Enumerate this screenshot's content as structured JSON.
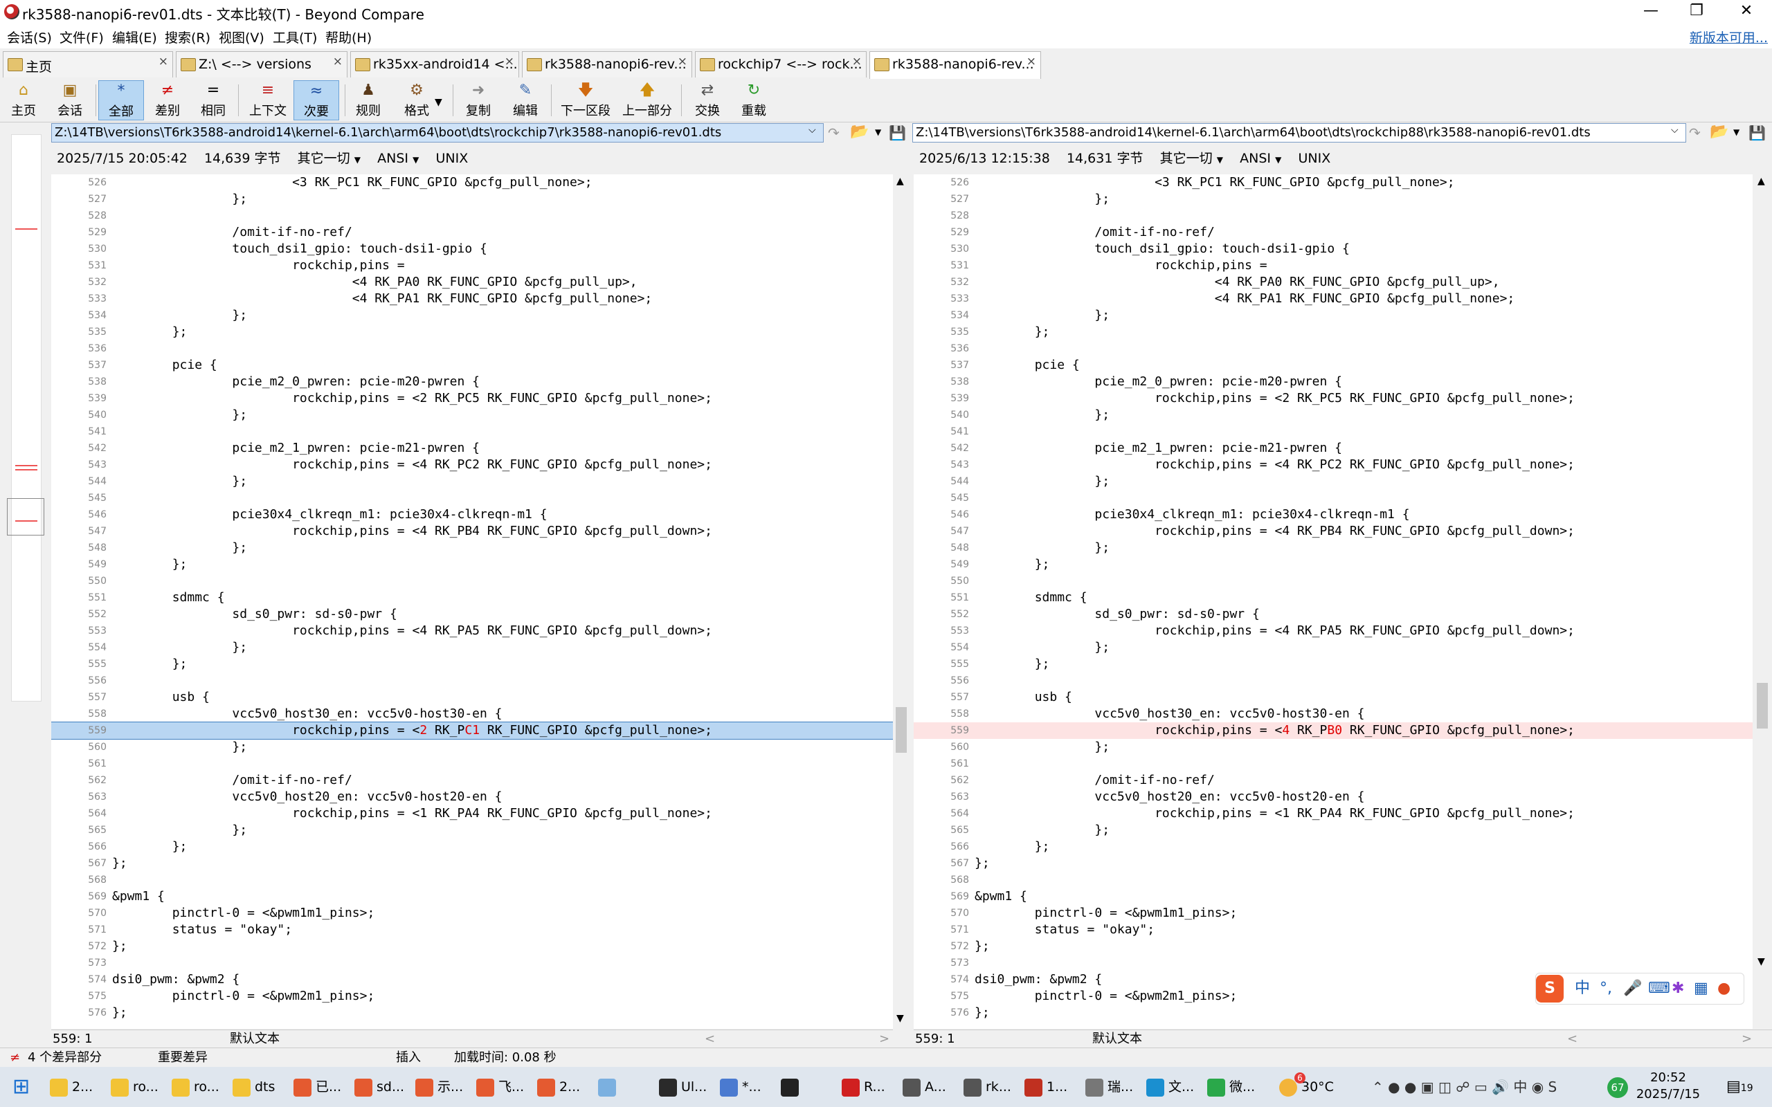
{
  "window": {
    "title": "rk3588-nanopi6-rev01.dts - 文本比较(T) - Beyond Compare"
  },
  "menu": {
    "items": [
      "会话(S)",
      "文件(F)",
      "编辑(E)",
      "搜索(R)",
      "视图(V)",
      "工具(T)",
      "帮助(H)"
    ],
    "new_version": "新版本可用..."
  },
  "tabs": [
    {
      "label": "主页"
    },
    {
      "label": "Z:\\ <--> versions"
    },
    {
      "label": "rk35xx-android14 <..."
    },
    {
      "label": "rk3588-nanopi6-rev..."
    },
    {
      "label": "rockchip7 <--> rock..."
    },
    {
      "label": "rk3588-nanopi6-rev..."
    }
  ],
  "toolbar": {
    "home": "主页",
    "session": "会话",
    "all": "全部",
    "diff": "差别",
    "same": "相同",
    "context": "上下文",
    "minor": "次要",
    "rules": "规则",
    "format": "格式",
    "copy": "复制",
    "edit": "编辑",
    "next_section": "下一区段",
    "prev_section": "上一部分",
    "swap": "交换",
    "reload": "重载"
  },
  "left": {
    "path": "Z:\\14TB\\versions\\T6rk3588-android14\\kernel-6.1\\arch\\arm64\\boot\\dts\\rockchip7\\rk3588-nanopi6-rev01.dts",
    "date": "2025/7/15 20:05:42",
    "size": "14,639 字节",
    "mode": "其它一切",
    "encoding": "ANSI",
    "eol": "UNIX",
    "pos": "559: 1",
    "syntax": "默认文本"
  },
  "right": {
    "path": "Z:\\14TB\\versions\\T6rk3588-android14\\kernel-6.1\\arch\\arm64\\boot\\dts\\rockchip88\\rk3588-nanopi6-rev01.dts",
    "date": "2025/6/13 12:15:38",
    "size": "14,631 字节",
    "mode": "其它一切",
    "encoding": "ANSI",
    "eol": "UNIX",
    "pos": "559: 1",
    "syntax": "默认文本"
  },
  "lines": [
    {
      "n": "526",
      "t": "                        <3 RK_PC1 RK_FUNC_GPIO &pcfg_pull_none>;"
    },
    {
      "n": "527",
      "t": "                };"
    },
    {
      "n": "528",
      "t": ""
    },
    {
      "n": "529",
      "t": "                /omit-if-no-ref/"
    },
    {
      "n": "530",
      "t": "                touch_dsi1_gpio: touch-dsi1-gpio {"
    },
    {
      "n": "531",
      "t": "                        rockchip,pins ="
    },
    {
      "n": "532",
      "t": "                                <4 RK_PA0 RK_FUNC_GPIO &pcfg_pull_up>,"
    },
    {
      "n": "533",
      "t": "                                <4 RK_PA1 RK_FUNC_GPIO &pcfg_pull_none>;"
    },
    {
      "n": "534",
      "t": "                };"
    },
    {
      "n": "535",
      "t": "        };"
    },
    {
      "n": "536",
      "t": ""
    },
    {
      "n": "537",
      "t": "        pcie {"
    },
    {
      "n": "538",
      "t": "                pcie_m2_0_pwren: pcie-m20-pwren {"
    },
    {
      "n": "539",
      "t": "                        rockchip,pins = <2 RK_PC5 RK_FUNC_GPIO &pcfg_pull_none>;"
    },
    {
      "n": "540",
      "t": "                };"
    },
    {
      "n": "541",
      "t": ""
    },
    {
      "n": "542",
      "t": "                pcie_m2_1_pwren: pcie-m21-pwren {"
    },
    {
      "n": "543",
      "t": "                        rockchip,pins = <4 RK_PC2 RK_FUNC_GPIO &pcfg_pull_none>;"
    },
    {
      "n": "544",
      "t": "                };"
    },
    {
      "n": "545",
      "t": ""
    },
    {
      "n": "546",
      "t": "                pcie30x4_clkreqn_m1: pcie30x4-clkreqn-m1 {"
    },
    {
      "n": "547",
      "t": "                        rockchip,pins = <4 RK_PB4 RK_FUNC_GPIO &pcfg_pull_down>;"
    },
    {
      "n": "548",
      "t": "                };"
    },
    {
      "n": "549",
      "t": "        };"
    },
    {
      "n": "550",
      "t": ""
    },
    {
      "n": "551",
      "t": "        sdmmc {"
    },
    {
      "n": "552",
      "t": "                sd_s0_pwr: sd-s0-pwr {"
    },
    {
      "n": "553",
      "t": "                        rockchip,pins = <4 RK_PA5 RK_FUNC_GPIO &pcfg_pull_down>;"
    },
    {
      "n": "554",
      "t": "                };"
    },
    {
      "n": "555",
      "t": "        };"
    },
    {
      "n": "556",
      "t": ""
    },
    {
      "n": "557",
      "t": "        usb {"
    },
    {
      "n": "558",
      "t": "                vcc5v0_host30_en: vcc5v0-host30-en {"
    },
    {
      "n": "559",
      "t": "DIFF"
    },
    {
      "n": "560",
      "t": "                };"
    },
    {
      "n": "561",
      "t": ""
    },
    {
      "n": "562",
      "t": "                /omit-if-no-ref/"
    },
    {
      "n": "563",
      "t": "                vcc5v0_host20_en: vcc5v0-host20-en {"
    },
    {
      "n": "564",
      "t": "                        rockchip,pins = <1 RK_PA4 RK_FUNC_GPIO &pcfg_pull_none>;"
    },
    {
      "n": "565",
      "t": "                };"
    },
    {
      "n": "566",
      "t": "        };"
    },
    {
      "n": "567",
      "t": "};"
    },
    {
      "n": "568",
      "t": ""
    },
    {
      "n": "569",
      "t": "&pwm1 {"
    },
    {
      "n": "570",
      "t": "        pinctrl-0 = <&pwm1m1_pins>;"
    },
    {
      "n": "571",
      "t": "        status = \"okay\";"
    },
    {
      "n": "572",
      "t": "};"
    },
    {
      "n": "573",
      "t": ""
    },
    {
      "n": "574",
      "t": "dsi0_pwm: &pwm2 {"
    },
    {
      "n": "575",
      "t": "        pinctrl-0 = <&pwm2m1_pins>;"
    },
    {
      "n": "576",
      "t": "};"
    }
  ],
  "diff_line": {
    "prefix": "                        rockchip,pins = <",
    "left": {
      "a": "2",
      "b": " RK_P",
      "c": "C1",
      "d": " RK_FUNC_GPIO &pcfg_pull_none>;"
    },
    "right": {
      "a": "4",
      "b": " RK_P",
      "c": "B0",
      "d": " RK_FUNC_GPIO &pcfg_pull_none>;"
    }
  },
  "status": {
    "diffs": "4 个差异部分",
    "importance": "重要差异",
    "insert": "插入",
    "load_time": "加载时间: 0.08 秒"
  },
  "taskbar": {
    "items": [
      "2...",
      "ro...",
      "ro...",
      "dts",
      "已...",
      "sd...",
      "示...",
      "飞...",
      "2...",
      "",
      "Ul...",
      "*...",
      "",
      "R...",
      "A...",
      "rk...",
      "1...",
      "瑞...",
      "文...",
      "微..."
    ],
    "weather": "30°C",
    "weather_badge": "6",
    "time": "20:52",
    "date": "2025/7/15",
    "notif": "19",
    "battery": "67"
  },
  "ime": {
    "lang": "中"
  }
}
